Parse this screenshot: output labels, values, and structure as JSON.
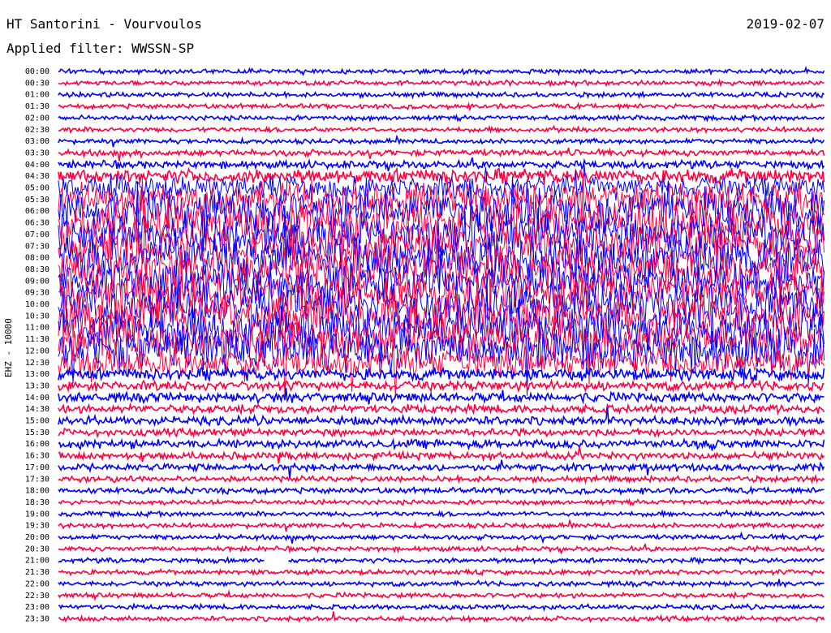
{
  "header": {
    "station": "HT Santorini - Vourvoulos",
    "date": "2019-02-07",
    "filter": "Applied filter: WWSSN-SP"
  },
  "colors": {
    "trace_a": "#0000ff",
    "trace_b": "#ff0040"
  },
  "chart_data": {
    "type": "line",
    "ylabel": "EHZ - 10000",
    "row_labels": [
      "00:00",
      "00:30",
      "01:00",
      "01:30",
      "02:00",
      "02:30",
      "03:00",
      "03:30",
      "04:00",
      "04:30",
      "05:00",
      "05:30",
      "06:00",
      "06:30",
      "07:00",
      "07:30",
      "08:00",
      "08:30",
      "09:00",
      "09:30",
      "10:00",
      "10:30",
      "11:00",
      "11:30",
      "12:00",
      "12:30",
      "13:00",
      "13:30",
      "14:00",
      "14:30",
      "15:00",
      "15:30",
      "16:00",
      "16:30",
      "17:00",
      "17:30",
      "18:00",
      "18:30",
      "19:00",
      "19:30",
      "20:00",
      "20:30",
      "21:00",
      "21:30",
      "22:00",
      "22:30",
      "23:00",
      "23:30"
    ],
    "relative_amplitude": [
      1,
      1,
      1,
      1,
      1,
      1,
      1,
      1.3,
      1.6,
      3,
      5,
      7,
      9,
      9,
      9,
      9,
      9,
      9,
      8,
      8,
      9,
      9,
      9,
      9,
      9,
      6,
      2.5,
      2,
      2,
      1.8,
      1.8,
      1.5,
      1.8,
      1.5,
      1.5,
      1.2,
      1.2,
      1,
      1,
      1,
      1,
      1,
      1,
      1,
      1,
      1,
      1,
      1
    ],
    "gaps": [
      {
        "row": "21:00",
        "from_fraction": 0.27,
        "to_fraction": 0.3
      }
    ]
  }
}
